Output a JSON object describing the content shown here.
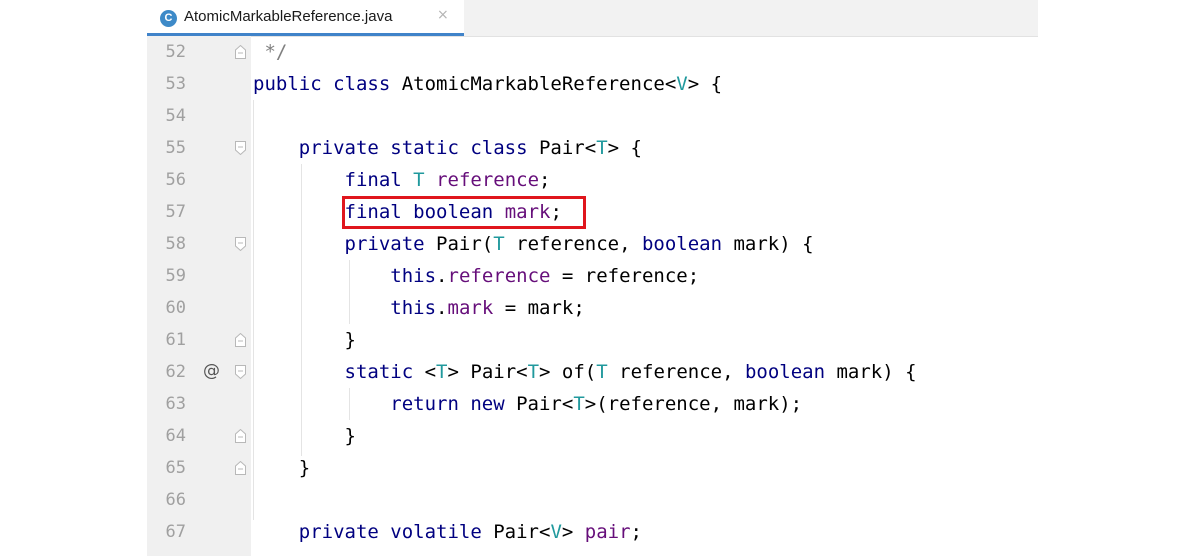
{
  "tab": {
    "icon": "C",
    "icon_name": "java-class-icon",
    "title": "AtomicMarkableReference.java",
    "close": "×"
  },
  "colors": {
    "keyword": "#000080",
    "field": "#660e7a",
    "type_param": "#20999d",
    "highlight": "#e0161d",
    "tab_accent": "#4083c9"
  },
  "lines": [
    {
      "num": "52",
      "indent": "",
      "tokens": [
        [
          " */",
          "c"
        ]
      ],
      "fold": "end"
    },
    {
      "num": "53",
      "indent": "",
      "tokens": [
        [
          "public class",
          "k"
        ],
        [
          " AtomicMarkableReference<",
          ""
        ],
        [
          "V",
          "t"
        ],
        [
          "> {",
          ""
        ]
      ]
    },
    {
      "num": "54",
      "indent": "",
      "tokens": []
    },
    {
      "num": "55",
      "indent": "    ",
      "tokens": [
        [
          "private static class",
          "k"
        ],
        [
          " Pair<",
          ""
        ],
        [
          "T",
          "t"
        ],
        [
          "> {",
          ""
        ]
      ],
      "fold": "start"
    },
    {
      "num": "56",
      "indent": "        ",
      "tokens": [
        [
          "final",
          "k"
        ],
        [
          " ",
          ""
        ],
        [
          "T",
          "t"
        ],
        [
          " ",
          ""
        ],
        [
          "reference",
          "f"
        ],
        [
          ";",
          ""
        ]
      ]
    },
    {
      "num": "57",
      "indent": "        ",
      "tokens": [
        [
          "final boolean",
          "k"
        ],
        [
          " ",
          ""
        ],
        [
          "mark",
          "f"
        ],
        [
          ";",
          ""
        ]
      ]
    },
    {
      "num": "58",
      "indent": "        ",
      "tokens": [
        [
          "private",
          "k"
        ],
        [
          " Pair(",
          ""
        ],
        [
          "T",
          "t"
        ],
        [
          " reference, ",
          ""
        ],
        [
          "boolean",
          "k"
        ],
        [
          " mark) {",
          ""
        ]
      ],
      "fold": "start"
    },
    {
      "num": "59",
      "indent": "            ",
      "tokens": [
        [
          "this",
          "k"
        ],
        [
          ".",
          ""
        ],
        [
          "reference",
          "f"
        ],
        [
          " = reference;",
          ""
        ]
      ]
    },
    {
      "num": "60",
      "indent": "            ",
      "tokens": [
        [
          "this",
          "k"
        ],
        [
          ".",
          ""
        ],
        [
          "mark",
          "f"
        ],
        [
          " = mark;",
          ""
        ]
      ]
    },
    {
      "num": "61",
      "indent": "        ",
      "tokens": [
        [
          "}",
          ""
        ]
      ],
      "fold": "end"
    },
    {
      "num": "62",
      "indent": "        ",
      "annotation": "@",
      "tokens": [
        [
          "static",
          "k"
        ],
        [
          " <",
          ""
        ],
        [
          "T",
          "t"
        ],
        [
          "> Pair<",
          ""
        ],
        [
          "T",
          "t"
        ],
        [
          "> of(",
          ""
        ],
        [
          "T",
          "t"
        ],
        [
          " reference, ",
          ""
        ],
        [
          "boolean",
          "k"
        ],
        [
          " mark) {",
          ""
        ]
      ],
      "fold": "start"
    },
    {
      "num": "63",
      "indent": "            ",
      "tokens": [
        [
          "return new",
          "k"
        ],
        [
          " Pair<",
          ""
        ],
        [
          "T",
          "t"
        ],
        [
          ">(reference, mark);",
          ""
        ]
      ]
    },
    {
      "num": "64",
      "indent": "        ",
      "tokens": [
        [
          "}",
          ""
        ]
      ],
      "fold": "end"
    },
    {
      "num": "65",
      "indent": "    ",
      "tokens": [
        [
          "}",
          ""
        ]
      ],
      "fold": "end"
    },
    {
      "num": "66",
      "indent": "",
      "tokens": []
    },
    {
      "num": "67",
      "indent": "    ",
      "tokens": [
        [
          "private volatile",
          "k"
        ],
        [
          " Pair<",
          ""
        ],
        [
          "V",
          "t"
        ],
        [
          "> ",
          ""
        ],
        [
          "pair",
          "f"
        ],
        [
          ";",
          ""
        ]
      ]
    }
  ]
}
